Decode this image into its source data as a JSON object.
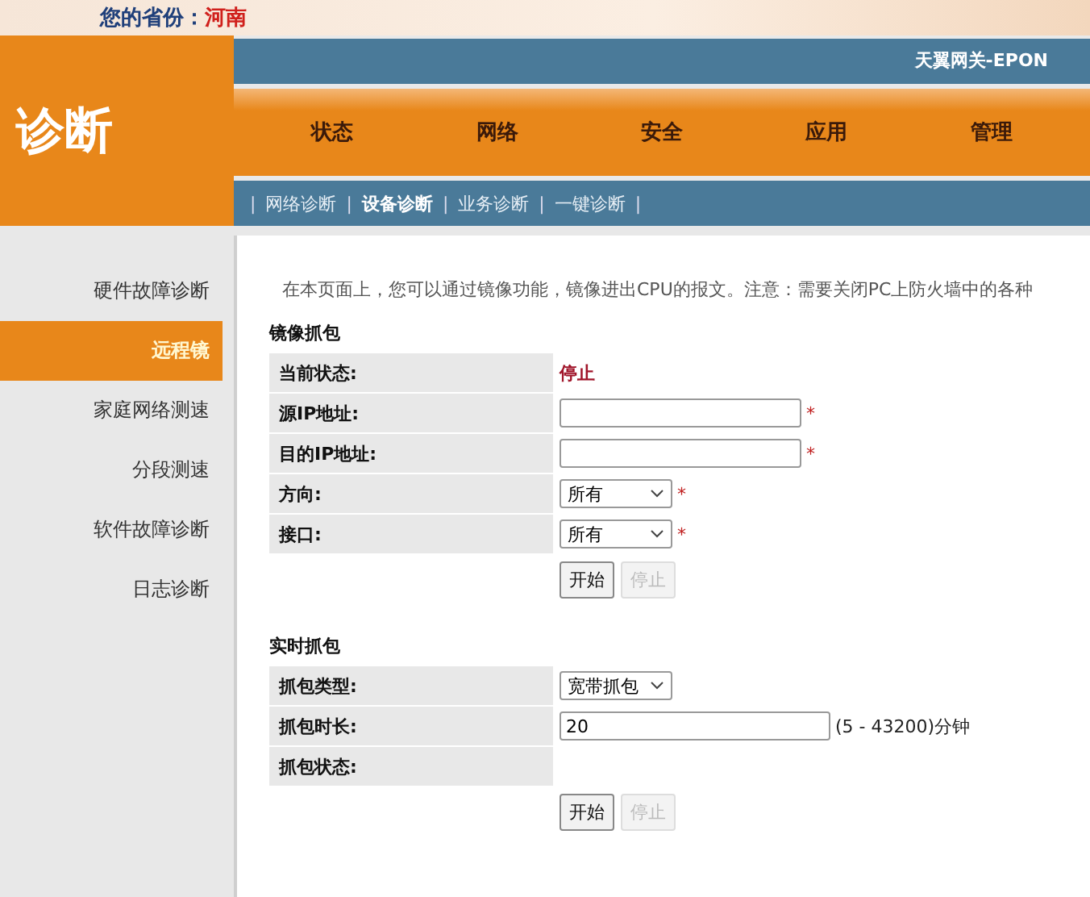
{
  "province": {
    "label": "您的省份：",
    "value": "河南"
  },
  "logo_title": "诊断",
  "brand": "天翼网关-EPON",
  "nav": [
    {
      "label": "状态"
    },
    {
      "label": "网络"
    },
    {
      "label": "安全"
    },
    {
      "label": "应用"
    },
    {
      "label": "管理"
    }
  ],
  "subnav_separator": "|",
  "required_mark": "*",
  "subnav": [
    {
      "label": "网络诊断",
      "selected": false
    },
    {
      "label": "设备诊断",
      "selected": true
    },
    {
      "label": "业务诊断",
      "selected": false
    },
    {
      "label": "一键诊断",
      "selected": false
    }
  ],
  "sidebar": [
    {
      "label": "硬件故障诊断",
      "selected": false
    },
    {
      "label": "远程镜",
      "selected": true
    },
    {
      "label": "家庭网络测速",
      "selected": false
    },
    {
      "label": "分段测速",
      "selected": false
    },
    {
      "label": "软件故障诊断",
      "selected": false
    },
    {
      "label": "日志诊断",
      "selected": false
    }
  ],
  "intro": "在本页面上，您可以通过镜像功能，镜像进出CPU的报文。注意：需要关闭PC上防火墙中的各种",
  "sections": [
    {
      "title": "镜像抓包",
      "rows": [
        {
          "label": "当前状态:",
          "kind": "status",
          "value": "停止"
        },
        {
          "label": "源IP地址:",
          "kind": "input",
          "value": "",
          "required": true
        },
        {
          "label": "目的IP地址:",
          "kind": "input",
          "value": "",
          "required": true
        },
        {
          "label": "方向:",
          "kind": "select",
          "value": "所有",
          "required": true
        },
        {
          "label": "接口:",
          "kind": "select",
          "value": "所有",
          "required": true
        }
      ],
      "buttons": [
        {
          "label": "开始",
          "disabled": false
        },
        {
          "label": "停止",
          "disabled": true
        }
      ]
    },
    {
      "title": "实时抓包",
      "rows": [
        {
          "label": "抓包类型:",
          "kind": "select",
          "value": "宽带抓包",
          "required": false
        },
        {
          "label": "抓包时长:",
          "kind": "input",
          "value": "20",
          "required": false,
          "suffix": "(5 - 43200)分钟"
        },
        {
          "label": "抓包状态:",
          "kind": "empty"
        }
      ],
      "buttons": [
        {
          "label": "开始",
          "disabled": false
        },
        {
          "label": "停止",
          "disabled": true
        }
      ]
    }
  ]
}
